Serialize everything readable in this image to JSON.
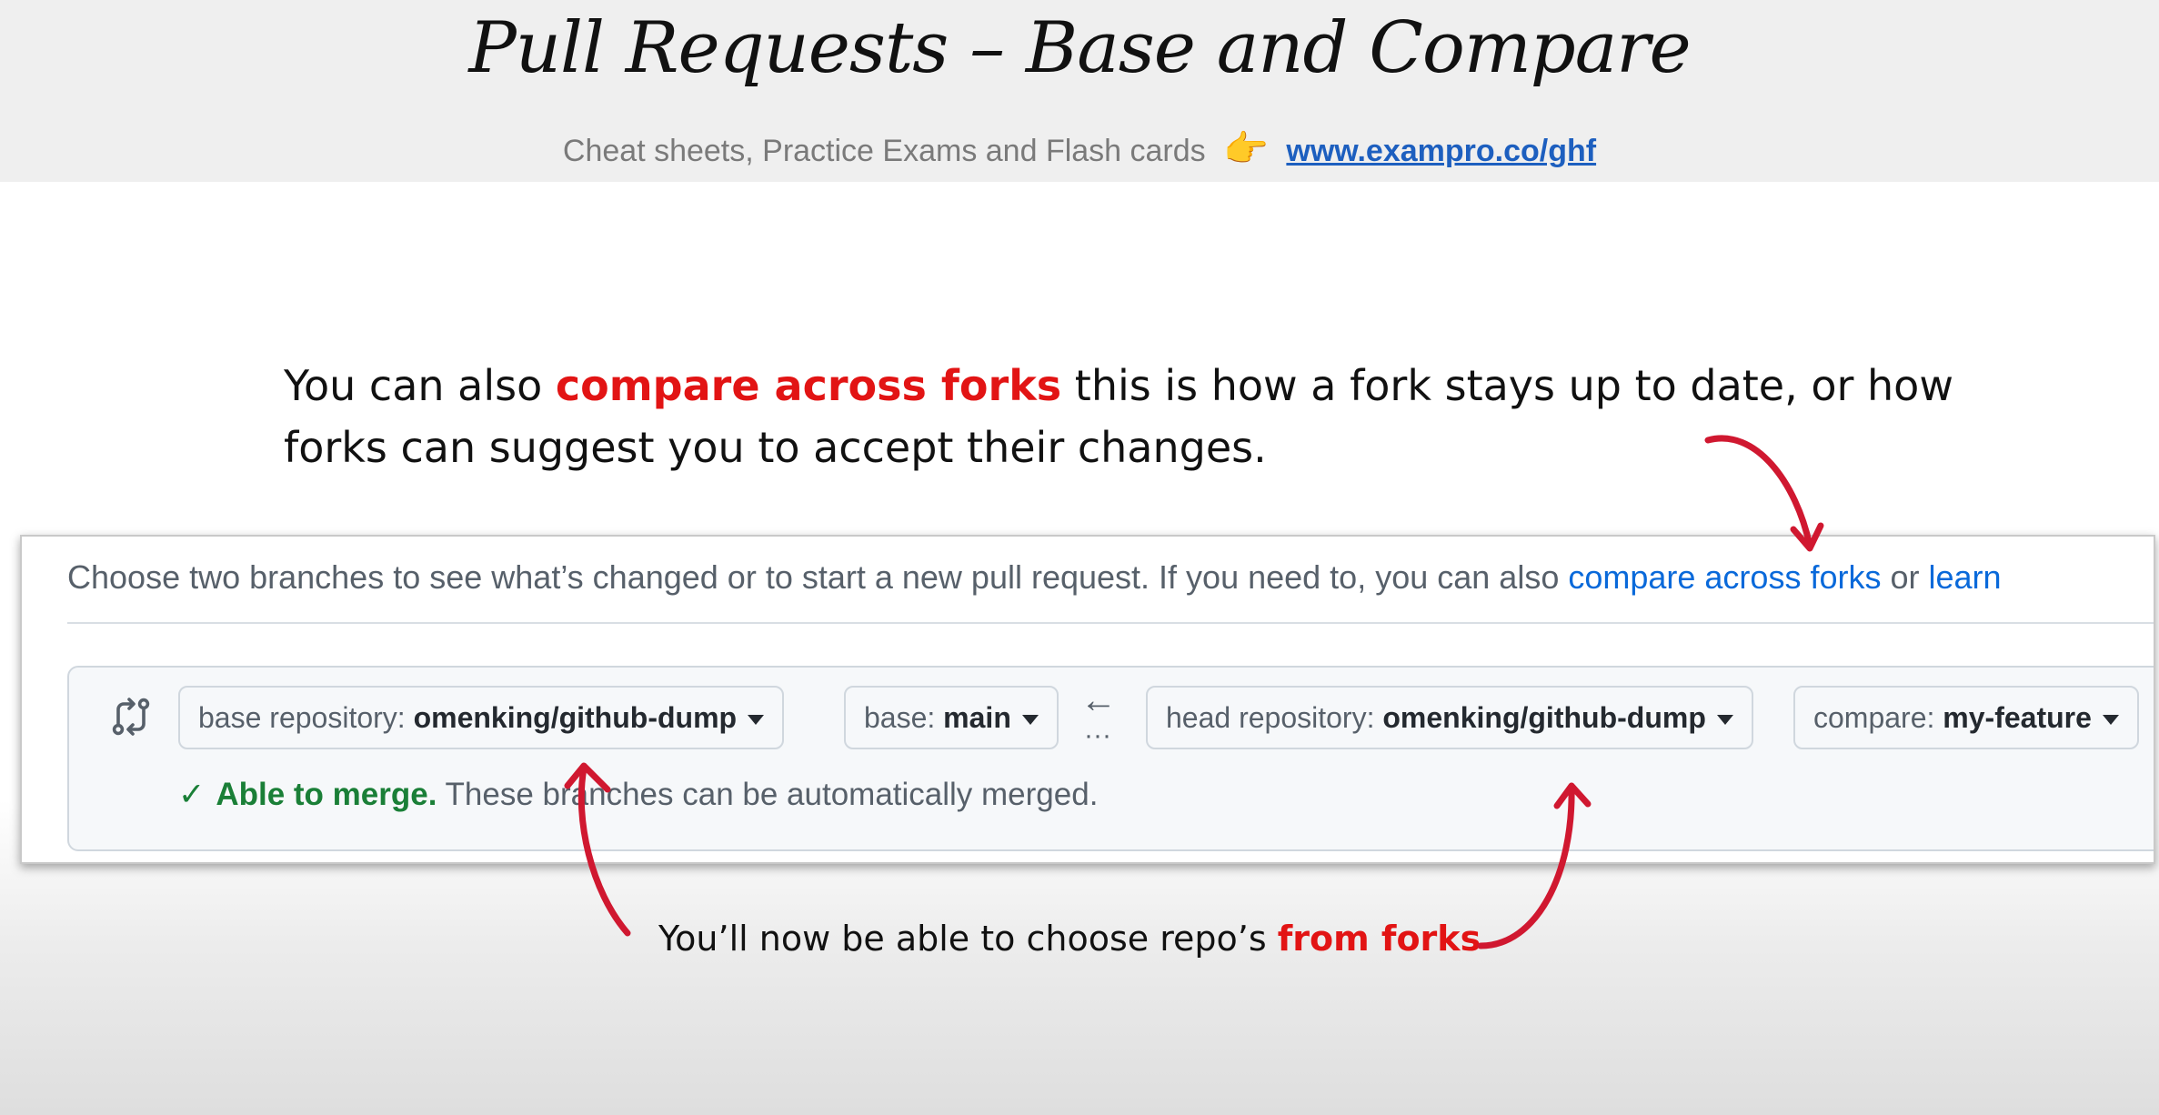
{
  "slide": {
    "title": "Pull Requests – Base and Compare",
    "subtitle_text": "Cheat sheets, Practice Exams and Flash cards",
    "subtitle_icon": "pointing-hand-emoji",
    "subtitle_link": "www.exampro.co/ghf",
    "intro_part1": "You can also ",
    "intro_highlight": "compare across forks",
    "intro_part2": " this is how a fork stays up to date, or how forks can suggest you to accept their changes.",
    "bottom_note_part1": "You’ll now be able to choose repo’s ",
    "bottom_note_highlight": "from forks"
  },
  "github": {
    "description": "Choose two branches to see what’s changed or to start a new pull request. If you need to, you can also ",
    "compare_link": "compare across forks",
    "or_text": " or ",
    "learn_link": "learn",
    "base_repo_label": "base repository: ",
    "base_repo_value": "omenking/github-dump",
    "base_label": "base: ",
    "base_value": "main",
    "arrow_icon": "left-arrow-icon",
    "head_repo_label": "head repository: ",
    "head_repo_value": "omenking/github-dump",
    "compare_label": "compare: ",
    "compare_value": "my-feature",
    "merge_status": "Able to merge.",
    "merge_message": " These branches can be automatically merged."
  },
  "colors": {
    "highlight_red": "#e21414",
    "link_blue": "#0969da",
    "success_green": "#1a7f37",
    "annotation_arrow": "#d01830"
  }
}
